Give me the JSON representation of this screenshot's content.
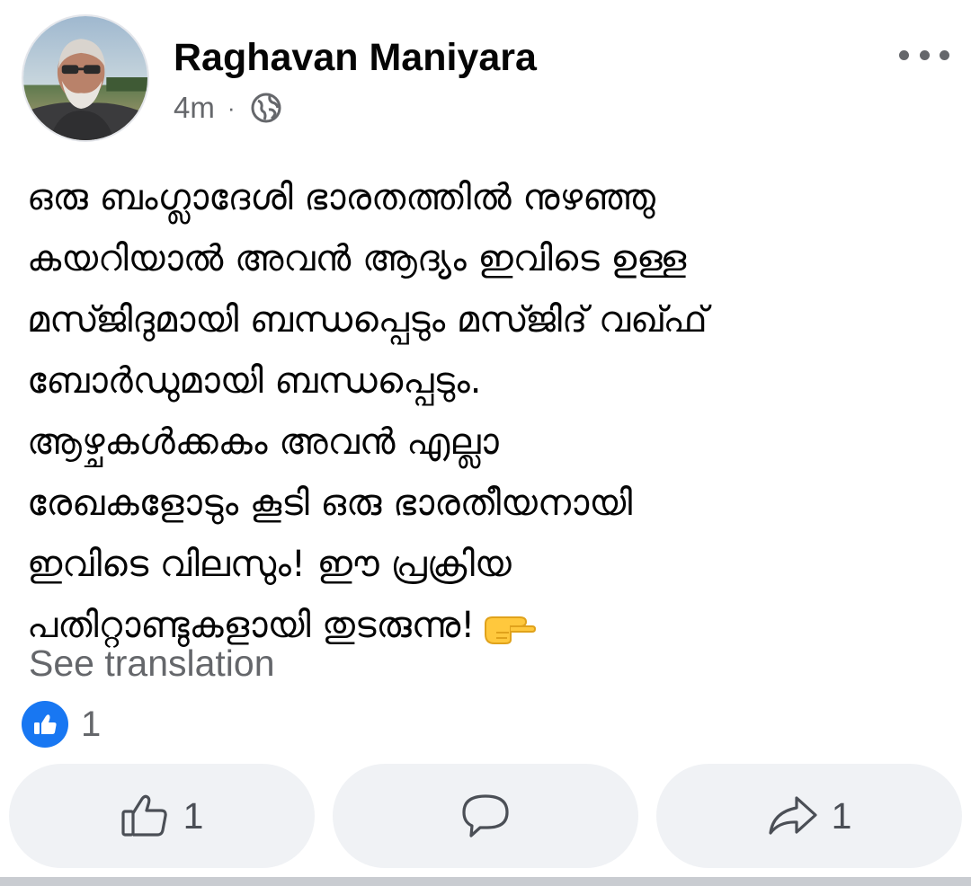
{
  "post": {
    "author_name": "Raghavan Maniyara",
    "timestamp": "4m",
    "separator": "·",
    "audience_icon": "globe-icon",
    "more_icon": "more-options-icon",
    "text_lines": [
      "ഒരു ബംഗ്ലാദേശി ഭാരതത്തിൽ നുഴഞ്ഞു",
      "കയറിയാൽ അവൻ ആദ്യം ഇവിടെ ഉള്ള",
      "മസ്ജിദുമായി ബന്ധപ്പെടും മസ്ജിദ്  വഖ്ഫ്",
      "ബോർഡുമായി ബന്ധപ്പെടും.",
      "ആഴ്ചകൾക്കകം അവൻ എല്ലാ",
      "രേഖകളോടും കൂടി ഒരു ഭാരതീയനായി",
      "ഇവിടെ വിലസും! ഈ പ്രക്രിയ",
      "പതിറ്റാണ്ടുകളായി തുടരുന്നു!"
    ],
    "text_emoji": "pointing-right-hand-emoji",
    "see_translation": "See translation"
  },
  "reactions": {
    "icon": "like-badge-icon",
    "count": "1"
  },
  "actions": {
    "like": {
      "icon": "thumbs-up-icon",
      "count": "1"
    },
    "comment": {
      "icon": "comment-icon"
    },
    "share": {
      "icon": "share-arrow-icon",
      "count": "1"
    }
  },
  "colors": {
    "accent": "#1877f2",
    "secondary_text": "#65676b",
    "button_background": "#f0f2f5"
  }
}
